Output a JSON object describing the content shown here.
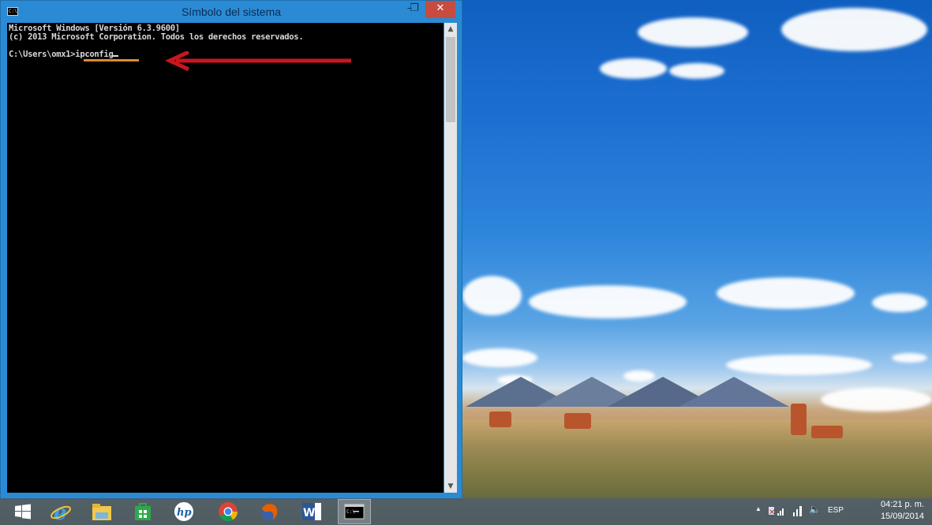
{
  "window": {
    "title": "Símbolo del sistema",
    "minimize_glyph": "–",
    "maximize_glyph": "❐",
    "close_glyph": "✕"
  },
  "console": {
    "lines": [
      "Microsoft Windows [Versión 6.3.9600]",
      "(c) 2013 Microsoft Corporation. Todos los derechos reservados.",
      "",
      "C:\\Users\\omx1>ipconfig"
    ]
  },
  "taskbar": {
    "items": [
      {
        "name": "start-button",
        "icon": "windows-logo-icon"
      },
      {
        "name": "internet-explorer",
        "icon": "ie-icon"
      },
      {
        "name": "file-explorer",
        "icon": "folder-icon"
      },
      {
        "name": "windows-store",
        "icon": "store-icon"
      },
      {
        "name": "hp",
        "icon": "hp-icon"
      },
      {
        "name": "chrome",
        "icon": "chrome-icon"
      },
      {
        "name": "firefox",
        "icon": "firefox-icon"
      },
      {
        "name": "word",
        "icon": "word-icon"
      },
      {
        "name": "command-prompt",
        "icon": "cmd-icon",
        "active": true
      }
    ],
    "tray": {
      "language": "ESP",
      "time": "04:21 p. m.",
      "date": "15/09/2014"
    }
  },
  "colors": {
    "annotation_arrow": "#c8161d",
    "annotation_underline": "#e08a2e",
    "close_button": "#c74b3f"
  }
}
